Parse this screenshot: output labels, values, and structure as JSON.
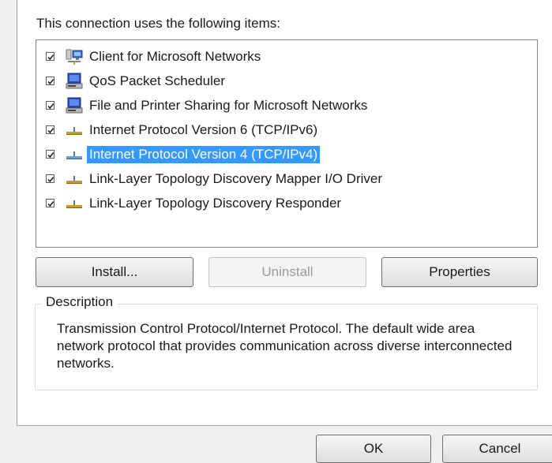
{
  "heading": "This connection uses the following items:",
  "items": [
    {
      "label": "Client for Microsoft Networks",
      "checked": true,
      "selected": false,
      "icon": "network-client-icon"
    },
    {
      "label": "QoS Packet Scheduler",
      "checked": true,
      "selected": false,
      "icon": "network-service-icon"
    },
    {
      "label": "File and Printer Sharing for Microsoft Networks",
      "checked": true,
      "selected": false,
      "icon": "network-service-icon"
    },
    {
      "label": "Internet Protocol Version 6 (TCP/IPv6)",
      "checked": true,
      "selected": false,
      "icon": "network-protocol-icon"
    },
    {
      "label": "Internet Protocol Version 4 (TCP/IPv4)",
      "checked": true,
      "selected": true,
      "icon": "network-protocol-icon"
    },
    {
      "label": "Link-Layer Topology Discovery Mapper I/O Driver",
      "checked": true,
      "selected": false,
      "icon": "network-protocol-icon"
    },
    {
      "label": "Link-Layer Topology Discovery Responder",
      "checked": true,
      "selected": false,
      "icon": "network-protocol-icon"
    }
  ],
  "buttons": {
    "install": "Install...",
    "uninstall": "Uninstall",
    "properties": "Properties"
  },
  "description": {
    "title": "Description",
    "text": "Transmission Control Protocol/Internet Protocol. The default wide area network protocol that provides communication across diverse interconnected networks."
  },
  "footer": {
    "ok": "OK",
    "cancel": "Cancel"
  },
  "colors": {
    "selection": "#3399ff",
    "selection_text": "#ffffff"
  }
}
